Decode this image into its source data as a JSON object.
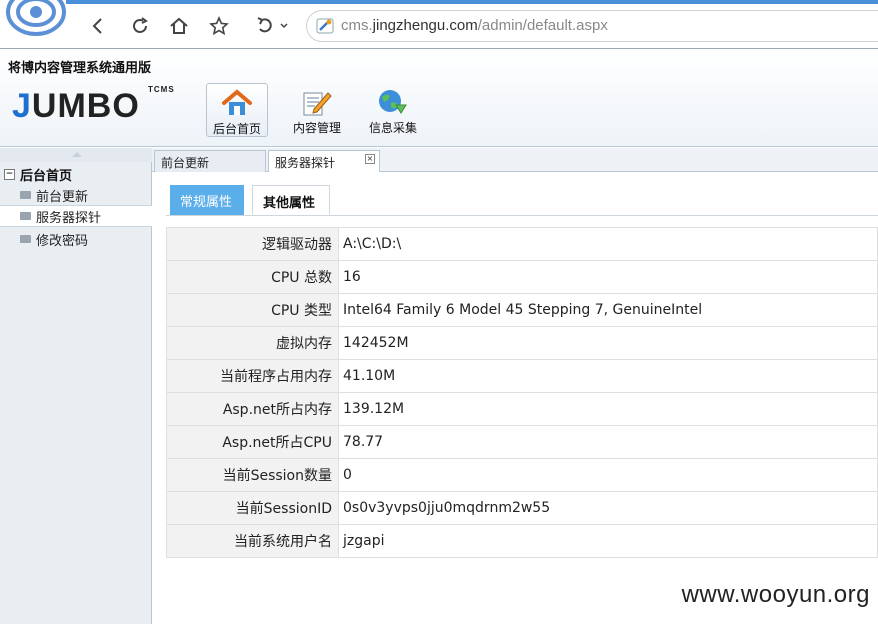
{
  "browser": {
    "url_prefix": "cms.",
    "url_domain": "jingzhengu.com",
    "url_path": "/admin/default.aspx"
  },
  "app": {
    "title": "将博内容管理系统通用版",
    "logo_text": "JUMBO",
    "logo_badge": "TCMS",
    "toolbar": [
      {
        "label": "后台首页",
        "icon": "home-icon",
        "active": true
      },
      {
        "label": "内容管理",
        "icon": "edit-icon",
        "active": false
      },
      {
        "label": "信息采集",
        "icon": "globe-icon",
        "active": false
      }
    ]
  },
  "sidebar": {
    "root": "后台首页",
    "items": [
      {
        "label": "前台更新"
      },
      {
        "label": "服务器探针"
      },
      {
        "label": "修改密码"
      }
    ]
  },
  "tabs": [
    {
      "label": "前台更新"
    },
    {
      "label": "服务器探针"
    }
  ],
  "subtabs": [
    {
      "label": "常规属性"
    },
    {
      "label": "其他属性"
    }
  ],
  "properties": [
    {
      "key": "逻辑驱动器",
      "value": "A:\\C:\\D:\\"
    },
    {
      "key": "CPU 总数",
      "value": "16"
    },
    {
      "key": "CPU 类型",
      "value": "Intel64 Family 6 Model 45 Stepping 7, GenuineIntel"
    },
    {
      "key": "虚拟内存",
      "value": "142452M"
    },
    {
      "key": "当前程序占用内存",
      "value": "41.10M"
    },
    {
      "key": "Asp.net所占内存",
      "value": "139.12M"
    },
    {
      "key": "Asp.net所占CPU",
      "value": "78.77"
    },
    {
      "key": "当前Session数量",
      "value": "0"
    },
    {
      "key": "当前SessionID",
      "value": "0s0v3yvps0jju0mqdrnm2w55"
    },
    {
      "key": "当前系统用户名",
      "value": "jzgapi"
    }
  ],
  "watermark": "www.wooyun.org",
  "colors": {
    "accent": "#5aaeea",
    "brand_blue": "#1f6fd0"
  }
}
